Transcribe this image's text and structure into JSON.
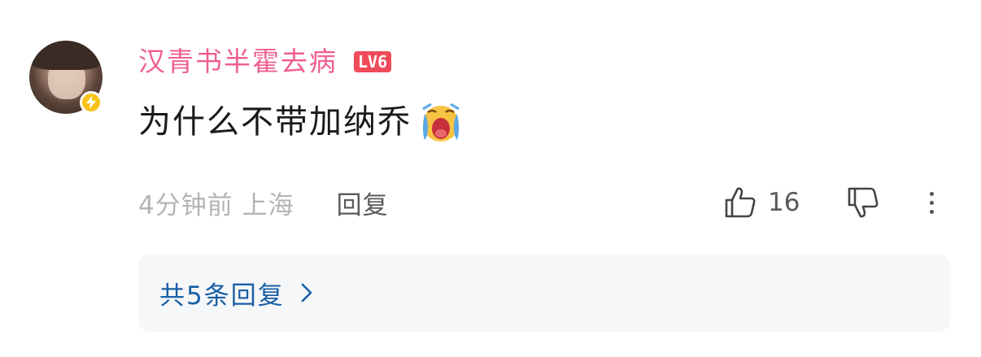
{
  "comment": {
    "username": "汉青书半霍去病",
    "level": "LV6",
    "text": "为什么不带加纳乔",
    "emoji": "crying-face-emoji",
    "time_location": "4分钟前 上海",
    "reply_label": "回复",
    "like_count": "16",
    "replies_summary": "共5条回复"
  },
  "colors": {
    "username": "#ef5f8f",
    "level_badge": "#ef4b5a",
    "replies_link": "#1a5fa6",
    "vip_badge": "#f7c21a"
  },
  "icons": {
    "like": "thumbs-up-icon",
    "dislike": "thumbs-down-icon",
    "more": "more-vertical-icon",
    "chevron": "chevron-right-icon",
    "vip": "lightning-icon"
  }
}
